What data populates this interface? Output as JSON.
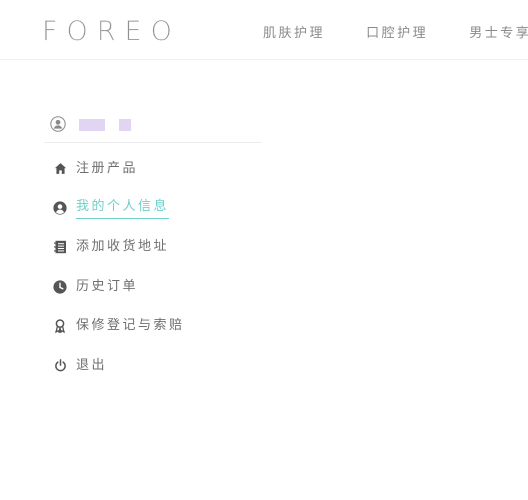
{
  "header": {
    "logo": "FOREO",
    "nav": [
      {
        "label": "肌肤护理"
      },
      {
        "label": "口腔护理"
      },
      {
        "label": "男士专享"
      }
    ]
  },
  "sidebar": {
    "menu": [
      {
        "label": "注册产品",
        "icon": "home-icon",
        "active": false
      },
      {
        "label": "我的个人信息",
        "icon": "user-circle-icon",
        "active": true
      },
      {
        "label": "添加收货地址",
        "icon": "address-book-icon",
        "active": false
      },
      {
        "label": "历史订单",
        "icon": "clock-icon",
        "active": false
      },
      {
        "label": "保修登记与索赔",
        "icon": "ribbon-icon",
        "active": false
      },
      {
        "label": "退出",
        "icon": "power-icon",
        "active": false
      }
    ]
  },
  "colors": {
    "accent": "#6fcfc9",
    "text": "#6f6f6f",
    "redaction": "#e2d4f3"
  }
}
